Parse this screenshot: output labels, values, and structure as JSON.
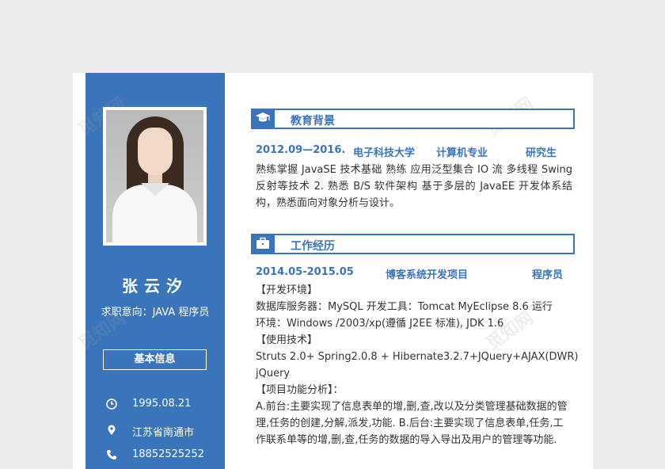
{
  "colors": {
    "accent": "#3a74bb",
    "text": "#333333",
    "background": "#ececec"
  },
  "profile": {
    "name": "张云汐",
    "intent": "求职意向：JAVA 程序员",
    "basic_info_label": "基本信息",
    "info": [
      {
        "icon": "clock-icon",
        "text": "1995.08.21"
      },
      {
        "icon": "location-icon",
        "text": "江苏省南通市"
      },
      {
        "icon": "phone-icon",
        "text": "18852525252"
      }
    ]
  },
  "education": {
    "title": "教育背景",
    "icon": "graduation-cap-icon",
    "date": "2012.09—2016.",
    "school": "电子科技大学",
    "major": "计算机专业",
    "degree": "研究生",
    "description": "熟练掌握 JavaSE 技术基础 熟练 应用泛型集合 IO 流 多线程 Swing 反射等技术 2. 熟悉 B/S 软件架构 基于多层的 JavaEE 开发体系结构，熟悉面向对象分析与设计。"
  },
  "work": {
    "title": "工作经历",
    "icon": "briefcase-icon",
    "date": "2014.05-2015.05",
    "project": "博客系统开发项目",
    "role": "程序员",
    "lines": [
      "【开发环境】",
      "数据库服务器：MySQL   开发工具：Tomcat MyEclipse 8.6   运行",
      "环境：Windows /2003/xp(遵循 J2EE 标准), JDK 1.6",
      "【使用技术】",
      "Struts 2.0+ Spring2.0.8 + Hibernate3.2.7+JQuery+AJAX(DWR)",
      "jQuery",
      "【项目功能分析】：",
      "A.前台:主要实现了信息表单的增,删,查,改以及分类管理基础数据的管",
      "理,任务的创建,分解,派发,功能.   B.后台:主要实现了信息表单,任务,工",
      "作联系单等的增,删,查,任务的数据的导入导出及用户的管理等功能."
    ]
  },
  "watermark": "觅知网"
}
